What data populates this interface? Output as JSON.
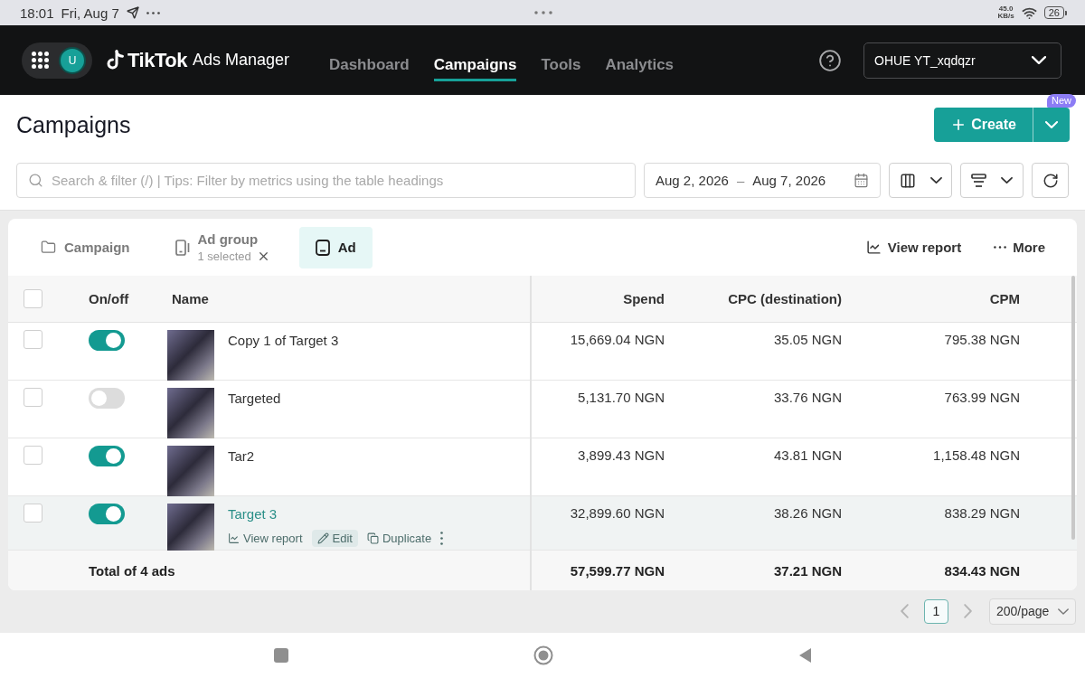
{
  "status_bar": {
    "time": "18:01",
    "date": "Fri, Aug 7",
    "net_speed": "45.0",
    "net_unit": "KB/s",
    "battery": "26"
  },
  "top_nav": {
    "avatar": "U",
    "brand": "TikTok",
    "product": "Ads Manager",
    "items": [
      {
        "label": "Dashboard",
        "selected": false
      },
      {
        "label": "Campaigns",
        "selected": true
      },
      {
        "label": "Tools",
        "selected": false
      },
      {
        "label": "Analytics",
        "selected": false
      }
    ],
    "account": "OHUE YT_xqdqzr"
  },
  "header": {
    "title": "Campaigns",
    "create": "Create",
    "badge": "New"
  },
  "filters": {
    "search_placeholder": "Search & filter (/) | Tips: Filter by metrics using the table headings",
    "date_start": "Aug 2, 2026",
    "date_separator": "–",
    "date_end": "Aug 7, 2026"
  },
  "levels": [
    {
      "kind": "campaign",
      "label": "Campaign",
      "selected": false
    },
    {
      "kind": "ad_group",
      "label": "Ad group",
      "note": "1 selected",
      "selected": false
    },
    {
      "kind": "ad",
      "label": "Ad",
      "selected": true
    }
  ],
  "actions": [
    {
      "kind": "report",
      "label": "View report"
    },
    {
      "kind": "more",
      "label": "More"
    }
  ],
  "table": {
    "all_checked": false,
    "columns": [
      "On/off",
      "Name",
      "Spend",
      "CPC (destination)",
      "CPM"
    ],
    "rows": [
      {
        "checked": false,
        "on": true,
        "name": "Copy 1 of Target 3",
        "spend": "15,669.04 NGN",
        "cpc": "35.05 NGN",
        "cpm": "795.38 NGN",
        "hovered": false
      },
      {
        "checked": false,
        "on": false,
        "name": "Targeted",
        "spend": "5,131.70 NGN",
        "cpc": "33.76 NGN",
        "cpm": "763.99 NGN",
        "hovered": false
      },
      {
        "checked": false,
        "on": true,
        "name": "Tar2",
        "spend": "3,899.43 NGN",
        "cpc": "43.81 NGN",
        "cpm": "1,158.48 NGN",
        "hovered": false
      },
      {
        "checked": false,
        "on": true,
        "name": "Target 3",
        "spend": "32,899.60 NGN",
        "cpc": "38.26 NGN",
        "cpm": "838.29 NGN",
        "hovered": true
      }
    ],
    "row_actions": [
      {
        "kind": "report",
        "label": "View report"
      },
      {
        "kind": "edit",
        "label": "Edit"
      },
      {
        "kind": "duplicate",
        "label": "Duplicate"
      },
      {
        "kind": "more"
      }
    ],
    "total": {
      "label": "Total of 4 ads",
      "spend": "57,599.77 NGN",
      "cpc": "37.21 NGN",
      "cpm": "834.43 NGN"
    }
  },
  "pagination": {
    "page": "1",
    "page_size": "200/page"
  }
}
